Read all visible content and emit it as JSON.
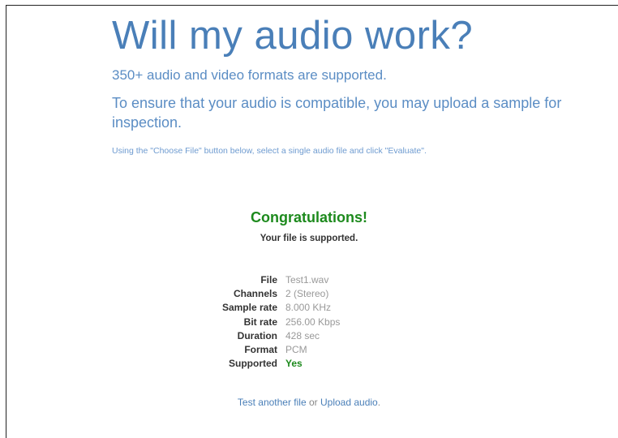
{
  "header": {
    "title": "Will my audio work?",
    "formats_text": "350+ audio and video formats are supported.",
    "compat_text": "To ensure that your audio is compatible, you may upload a sample for inspection.",
    "instruction_text": "Using the \"Choose File\" button below, select a single audio file and click \"Evaluate\"."
  },
  "result": {
    "heading": "Congratulations!",
    "message": "Your file is supported.",
    "rows": [
      {
        "label": "File",
        "value": "Test1.wav"
      },
      {
        "label": "Channels",
        "value": "2 (Stereo)"
      },
      {
        "label": "Sample rate",
        "value": "8.000 KHz"
      },
      {
        "label": "Bit rate",
        "value": "256.00 Kbps"
      },
      {
        "label": "Duration",
        "value": "428 sec"
      },
      {
        "label": "Format",
        "value": "PCM"
      },
      {
        "label": "Supported",
        "value": "Yes"
      }
    ]
  },
  "footer": {
    "test_another_label": "Test another file",
    "or_text": "or",
    "upload_label": "Upload audio",
    "period": "."
  },
  "colors": {
    "accent_blue": "#4a7fb8",
    "success_green": "#1d8a1d"
  }
}
